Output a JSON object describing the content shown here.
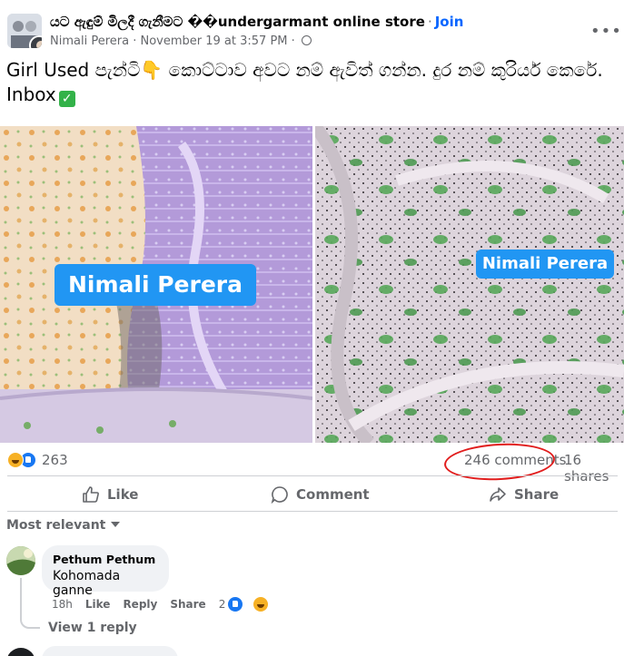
{
  "group": {
    "name": "යට ඇඳුම් මිලදී ගැනීමට ��undergarmant online store",
    "separator": "·",
    "join_label": "Join"
  },
  "post": {
    "author": "Nimali Perera",
    "date": "November 19 at 3:57 PM",
    "date_separator": "·",
    "caption": "Girl Used පැන්ටි👇 කොට්ටාව අවට නම් ඇවිත් ගන්න. දුර නම් කුරියර් කෙරේ. Inbox",
    "photo_watermarks": [
      "Nimali Perera",
      "Nimali Perera"
    ],
    "more_icon": "more-dots-icon"
  },
  "stats": {
    "reactions_count": "263",
    "comments_count": "246 comments",
    "shares_count": "16 shares",
    "highlight_color": "#e11d1d"
  },
  "actions": {
    "like_label": "Like",
    "comment_label": "Comment",
    "share_label": "Share"
  },
  "comments": {
    "sort_label": "Most relevant",
    "items": [
      {
        "name": "Pethum Pethum",
        "text": "Kohomada ganne",
        "time": "18h",
        "like_label": "Like",
        "reply_label": "Reply",
        "share_label": "Share",
        "reactions": "2",
        "view_replies": "View 1 reply"
      }
    ]
  },
  "colors": {
    "accent": "#0866ff",
    "watermark": "#2196f3",
    "muted": "#65676b"
  }
}
